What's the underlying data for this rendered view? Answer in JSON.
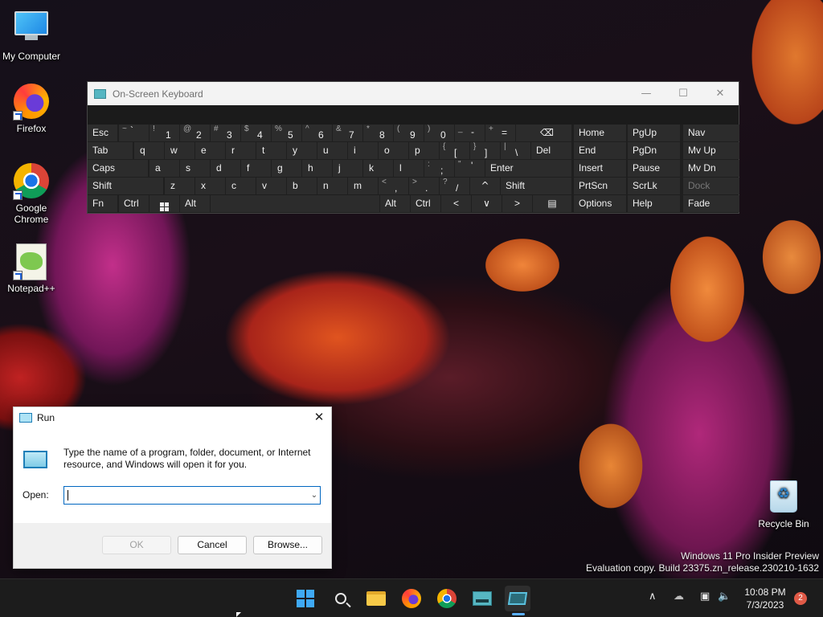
{
  "desktop": {
    "icons": [
      {
        "label": "My Computer"
      },
      {
        "label": "Firefox"
      },
      {
        "label": "Google Chrome"
      },
      {
        "label": "Notepad++"
      },
      {
        "label": "Recycle Bin"
      }
    ]
  },
  "osk": {
    "title": "On-Screen Keyboard",
    "controls": {
      "minimize": "—",
      "maximize": "☐",
      "close": "✕"
    },
    "rows": {
      "r1": [
        "Esc",
        "~",
        "`",
        "!",
        "1",
        "@",
        "2",
        "#",
        "3",
        "$",
        "4",
        "%",
        "5",
        "^",
        "6",
        "&",
        "7",
        "*",
        "8",
        "(",
        "9",
        ")",
        "0",
        "_",
        "-",
        "+",
        "=",
        "⌫"
      ],
      "r2": [
        "Tab",
        "q",
        "w",
        "e",
        "r",
        "t",
        "y",
        "u",
        "i",
        "o",
        "p",
        "{",
        "[",
        "}",
        "]",
        "|",
        "\\",
        "Del"
      ],
      "r3": [
        "Caps",
        "a",
        "s",
        "d",
        "f",
        "g",
        "h",
        "j",
        "k",
        "l",
        ":",
        ";",
        "\"",
        "'",
        "Enter"
      ],
      "r4": [
        "Shift",
        "z",
        "x",
        "c",
        "v",
        "b",
        "n",
        "m",
        "<",
        ",",
        ">",
        ".",
        "?",
        "/",
        "^",
        "Shift"
      ],
      "r5": [
        "Fn",
        "Ctrl",
        "Alt",
        "Alt",
        "Ctrl",
        "<",
        "∨",
        ">",
        "▤"
      ]
    },
    "nav": [
      "Home",
      "PgUp",
      "Nav",
      "End",
      "PgDn",
      "Mv Up",
      "Insert",
      "Pause",
      "Mv Dn",
      "PrtScn",
      "ScrLk",
      "Dock",
      "Options",
      "Help",
      "Fade"
    ]
  },
  "run": {
    "title": "Run",
    "close": "✕",
    "description": "Type the name of a program, folder, document, or Internet resource, and Windows will open it for you.",
    "open_label": "Open:",
    "open_value": "",
    "dropdown": "⌄",
    "buttons": {
      "ok": "OK",
      "cancel": "Cancel",
      "browse": "Browse..."
    }
  },
  "watermark": {
    "line1": "Windows 11 Pro Insider Preview",
    "line2": "Evaluation copy. Build 23375.zn_release.230210-1632"
  },
  "taskbar": {
    "apps": [
      "start-button",
      "search-button",
      "file-explorer-button",
      "firefox-button",
      "chrome-button",
      "touch-keyboard-button",
      "on-screen-keyboard-button"
    ],
    "tray": {
      "overflow": "∧",
      "network": "☁",
      "monitor": "▣",
      "volume": "🔈"
    },
    "clock": {
      "time": "10:08 PM",
      "date": "7/3/2023"
    },
    "notifications": "2"
  },
  "colors": {
    "accent": "#0067c0",
    "taskbar_indicator": "#5bb0ff",
    "notification_badge": "#e05a47"
  }
}
